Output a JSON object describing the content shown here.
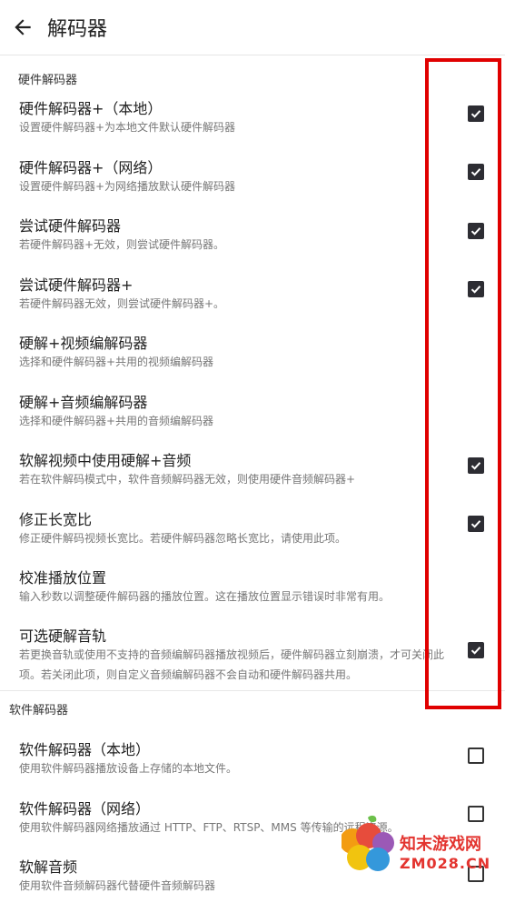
{
  "appbar": {
    "title": "解码器",
    "back_icon": "arrow-left-icon"
  },
  "hardware_section": {
    "header": "硬件解码器",
    "items": [
      {
        "title": "硬件解码器+（本地）",
        "subtitle": "设置硬件解码器+为本地文件默认硬件解码器",
        "checked": true
      },
      {
        "title": "硬件解码器+（网络）",
        "subtitle": "设置硬件解码器+为网络播放默认硬件解码器",
        "checked": true
      },
      {
        "title": "尝试硬件解码器",
        "subtitle": "若硬件解码器+无效，则尝试硬件解码器。",
        "checked": true
      },
      {
        "title": "尝试硬件解码器+",
        "subtitle": "若硬件解码器无效，则尝试硬件解码器+。",
        "checked": true
      },
      {
        "title": "硬解+视频编解码器",
        "subtitle": "选择和硬件解码器+共用的视频编解码器",
        "checked": null
      },
      {
        "title": "硬解+音频编解码器",
        "subtitle": "选择和硬件解码器+共用的音频编解码器",
        "checked": null
      },
      {
        "title": "软解视频中使用硬解+音频",
        "subtitle": "若在软件解码模式中，软件音频解码器无效，则使用硬件音频解码器+",
        "checked": true
      },
      {
        "title": "修正长宽比",
        "subtitle": "修正硬件解码视频长宽比。若硬件解码器忽略长宽比，请使用此项。",
        "checked": true
      },
      {
        "title": "校准播放位置",
        "subtitle": "输入秒数以调整硬件解码器的播放位置。这在播放位置显示错误时非常有用。",
        "checked": null
      },
      {
        "title": "可选硬解音轨",
        "subtitle": "若更换音轨或使用不支持的音频编解码器播放视频后，硬件解码器立刻崩溃，才可关闭此项。若关闭此项，则自定义音频编解码器不会自动和硬件解码器共用。",
        "checked": true
      }
    ]
  },
  "software_section": {
    "header": "软件解码器",
    "items": [
      {
        "title": "软件解码器（本地）",
        "subtitle": "使用软件解码器播放设备上存储的本地文件。",
        "checked": false
      },
      {
        "title": "软件解码器（网络）",
        "subtitle": "使用软件解码器网络播放通过 HTTP、FTP、RTSP、MMS 等传输的远程资源。",
        "checked": false
      },
      {
        "title": "软解音频",
        "subtitle": "使用软件音频解码器代替硬件音频解码器",
        "checked": false
      }
    ]
  },
  "watermark": {
    "text": "知末游戏网",
    "url": "ZM028.CN"
  },
  "colors": {
    "highlight": "#e00000",
    "checkbox": "#2d2d33",
    "watermark": "#e3342f"
  }
}
